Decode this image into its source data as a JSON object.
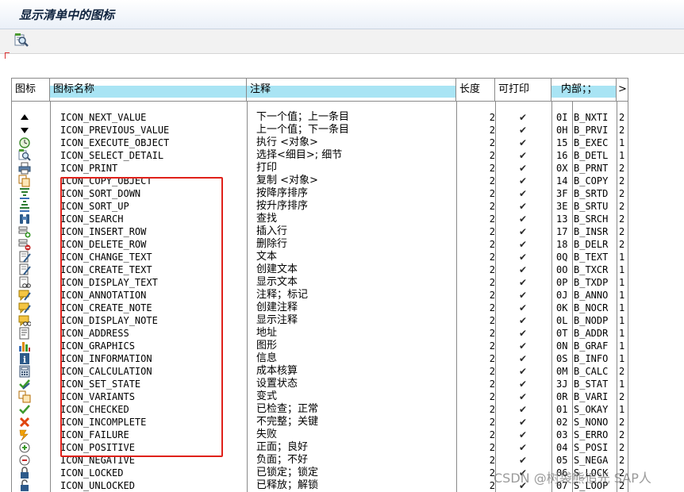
{
  "window": {
    "title": "显示清单中的图标"
  },
  "toolbar": {
    "find_icon": "magnifier-icon"
  },
  "table": {
    "headers": {
      "icon": "图标",
      "name": "图标名称",
      "comment": "注释",
      "length": "长度",
      "printable": "可打印",
      "internal": "内部；；",
      "more": ">"
    },
    "rows": [
      {
        "icon": "triangle-up-icon",
        "name": "ICON_NEXT_VALUE",
        "comment": "下一个值；上一条目",
        "len": "2",
        "print": "✔",
        "c1": "0I",
        "c2": "B_NXTI",
        "c3": "2"
      },
      {
        "icon": "triangle-down-icon",
        "name": "ICON_PREVIOUS_VALUE",
        "comment": "上一个值；下一条目",
        "len": "2",
        "print": "✔",
        "c1": "0H",
        "c2": "B_PRVI",
        "c3": "2"
      },
      {
        "icon": "execute-clock-icon",
        "name": "ICON_EXECUTE_OBJECT",
        "comment": "执行 <对象>",
        "len": "2",
        "print": "✔",
        "c1": "15",
        "c2": "B_EXEC",
        "c3": "1"
      },
      {
        "icon": "select-detail-icon",
        "name": "ICON_SELECT_DETAIL",
        "comment": "选择<细目>; 细节",
        "len": "2",
        "print": "✔",
        "c1": "16",
        "c2": "B_DETL",
        "c3": "1"
      },
      {
        "icon": "printer-icon",
        "name": "ICON_PRINT",
        "comment": "打印",
        "len": "2",
        "print": "✔",
        "c1": "0X",
        "c2": "B_PRNT",
        "c3": "2"
      },
      {
        "icon": "copy-icon",
        "name": "ICON_COPY_OBJECT",
        "comment": "复制 <对象>",
        "len": "2",
        "print": "✔",
        "c1": "14",
        "c2": "B_COPY",
        "c3": "2"
      },
      {
        "icon": "sort-down-icon",
        "name": "ICON_SORT_DOWN",
        "comment": "按降序排序",
        "len": "2",
        "print": "✔",
        "c1": "3F",
        "c2": "B_SRTD",
        "c3": "2"
      },
      {
        "icon": "sort-up-icon",
        "name": "ICON_SORT_UP",
        "comment": "按升序排序",
        "len": "2",
        "print": "✔",
        "c1": "3E",
        "c2": "B_SRTU",
        "c3": "2"
      },
      {
        "icon": "binoculars-icon",
        "name": "ICON_SEARCH",
        "comment": "查找",
        "len": "2",
        "print": "✔",
        "c1": "13",
        "c2": "B_SRCH",
        "c3": "2"
      },
      {
        "icon": "insert-row-icon",
        "name": "ICON_INSERT_ROW",
        "comment": "插入行",
        "len": "2",
        "print": "✔",
        "c1": "17",
        "c2": "B_INSR",
        "c3": "2"
      },
      {
        "icon": "delete-row-icon",
        "name": "ICON_DELETE_ROW",
        "comment": "删除行",
        "len": "2",
        "print": "✔",
        "c1": "18",
        "c2": "B_DELR",
        "c3": "2"
      },
      {
        "icon": "change-text-icon",
        "name": "ICON_CHANGE_TEXT",
        "comment": "文本",
        "len": "2",
        "print": "✔",
        "c1": "0Q",
        "c2": "B_TEXT",
        "c3": "1"
      },
      {
        "icon": "create-text-icon",
        "name": "ICON_CREATE_TEXT",
        "comment": "创建文本",
        "len": "2",
        "print": "✔",
        "c1": "0O",
        "c2": "B_TXCR",
        "c3": "1"
      },
      {
        "icon": "display-text-icon",
        "name": "ICON_DISPLAY_TEXT",
        "comment": "显示文本",
        "len": "2",
        "print": "✔",
        "c1": "0P",
        "c2": "B_TXDP",
        "c3": "1"
      },
      {
        "icon": "annotation-icon",
        "name": "ICON_ANNOTATION",
        "comment": "注释；标记",
        "len": "2",
        "print": "✔",
        "c1": "0J",
        "c2": "B_ANNO",
        "c3": "1"
      },
      {
        "icon": "create-note-icon",
        "name": "ICON_CREATE_NOTE",
        "comment": "创建注释",
        "len": "2",
        "print": "✔",
        "c1": "0K",
        "c2": "B_NOCR",
        "c3": "1"
      },
      {
        "icon": "display-note-icon",
        "name": "ICON_DISPLAY_NOTE",
        "comment": "显示注释",
        "len": "2",
        "print": "✔",
        "c1": "0L",
        "c2": "B_NODP",
        "c3": "1"
      },
      {
        "icon": "address-icon",
        "name": "ICON_ADDRESS",
        "comment": "地址",
        "len": "2",
        "print": "✔",
        "c1": "0T",
        "c2": "B_ADDR",
        "c3": "1"
      },
      {
        "icon": "graphics-icon",
        "name": "ICON_GRAPHICS",
        "comment": "图形",
        "len": "2",
        "print": "✔",
        "c1": "0N",
        "c2": "B_GRAF",
        "c3": "1"
      },
      {
        "icon": "information-icon",
        "name": "ICON_INFORMATION",
        "comment": "信息",
        "len": "2",
        "print": "✔",
        "c1": "0S",
        "c2": "B_INFO",
        "c3": "1"
      },
      {
        "icon": "calculator-icon",
        "name": "ICON_CALCULATION",
        "comment": "成本核算",
        "len": "2",
        "print": "✔",
        "c1": "0M",
        "c2": "B_CALC",
        "c3": "2"
      },
      {
        "icon": "set-state-icon",
        "name": "ICON_SET_STATE",
        "comment": "设置状态",
        "len": "2",
        "print": "✔",
        "c1": "3J",
        "c2": "B_STAT",
        "c3": "1"
      },
      {
        "icon": "variants-icon",
        "name": "ICON_VARIANTS",
        "comment": "变式",
        "len": "2",
        "print": "✔",
        "c1": "0R",
        "c2": "B_VARI",
        "c3": "2"
      },
      {
        "icon": "checked-icon",
        "name": "ICON_CHECKED",
        "comment": "已检查；正常",
        "len": "2",
        "print": "✔",
        "c1": "01",
        "c2": "S_OKAY",
        "c3": "1"
      },
      {
        "icon": "incomplete-icon",
        "name": "ICON_INCOMPLETE",
        "comment": "不完整；关键",
        "len": "2",
        "print": "✔",
        "c1": "02",
        "c2": "S_NONO",
        "c3": "2"
      },
      {
        "icon": "failure-icon",
        "name": "ICON_FAILURE",
        "comment": "失败",
        "len": "2",
        "print": "✔",
        "c1": "03",
        "c2": "S_ERRO",
        "c3": "2"
      },
      {
        "icon": "positive-icon",
        "name": "ICON_POSITIVE",
        "comment": "正面；良好",
        "len": "2",
        "print": "✔",
        "c1": "04",
        "c2": "S_POSI",
        "c3": "2"
      },
      {
        "icon": "negative-icon",
        "name": "ICON_NEGATIVE",
        "comment": "负面；不好",
        "len": "2",
        "print": "✔",
        "c1": "05",
        "c2": "S_NEGA",
        "c3": "2"
      },
      {
        "icon": "locked-icon",
        "name": "ICON_LOCKED",
        "comment": "已锁定；锁定",
        "len": "2",
        "print": "✔",
        "c1": "06",
        "c2": "S_LOCK",
        "c3": "2"
      },
      {
        "icon": "unlocked-icon",
        "name": "ICON_UNLOCKED",
        "comment": "已释放；解锁",
        "len": "2",
        "print": "✔",
        "c1": "07",
        "c2": "S_LOOP",
        "c3": "2"
      }
    ]
  },
  "watermark": "CSDN @树袋熊追光 SAP人",
  "colors": {
    "header_highlight": "#a9e4f4",
    "highlight_box": "#e0211a"
  }
}
